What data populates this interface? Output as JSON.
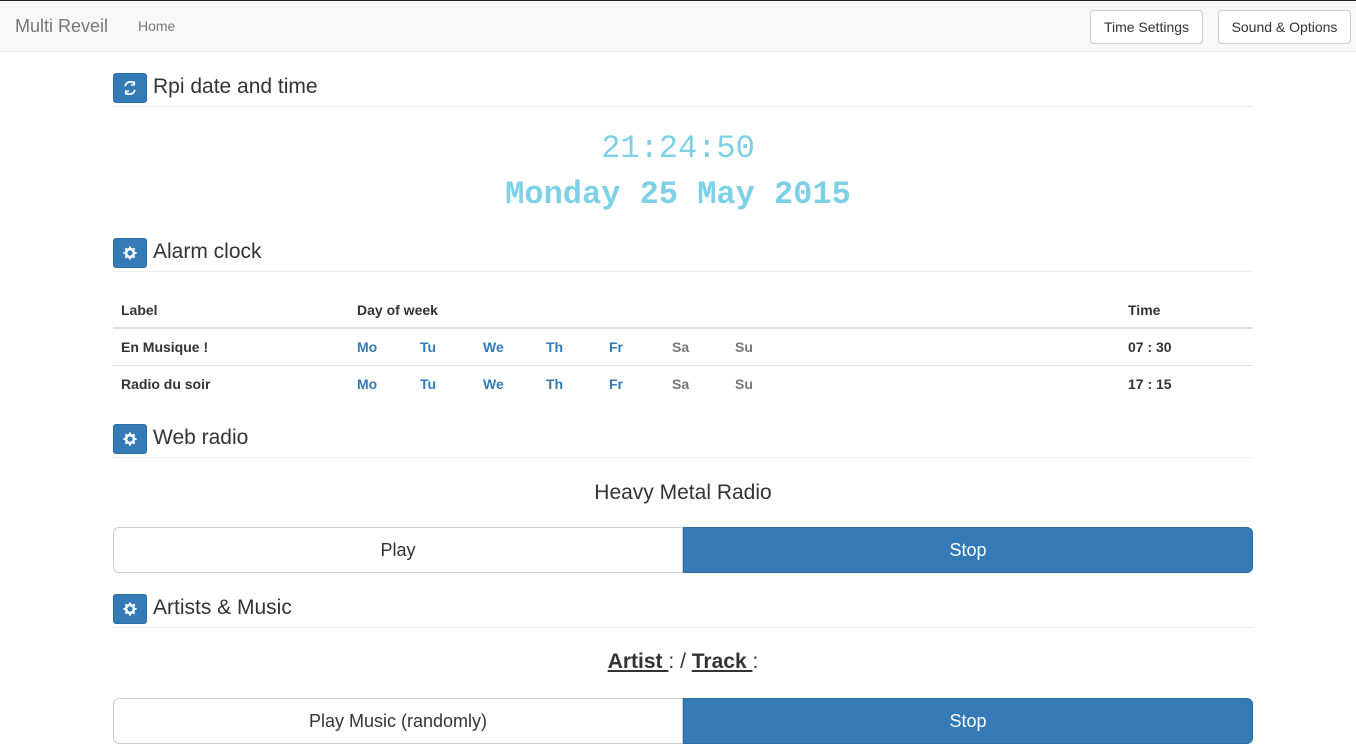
{
  "navbar": {
    "brand": "Multi Reveil",
    "home": "Home",
    "time_settings": "Time Settings",
    "sound_options": "Sound & Options"
  },
  "sections": {
    "datetime": {
      "title": "Rpi date and time",
      "icon": "refresh-icon"
    },
    "alarm": {
      "title": "Alarm clock",
      "icon": "gear-icon"
    },
    "radio": {
      "title": "Web radio",
      "icon": "gear-icon"
    },
    "music": {
      "title": "Artists & Music",
      "icon": "gear-icon"
    }
  },
  "clock": {
    "time": "21:24:50",
    "date": "Monday 25 May 2015"
  },
  "alarm_table": {
    "headers": [
      "Label",
      "Day of week",
      "",
      "Time"
    ],
    "rows": [
      {
        "label": "En Musique !",
        "days": [
          {
            "d": "Mo",
            "active": true
          },
          {
            "d": "Tu",
            "active": true
          },
          {
            "d": "We",
            "active": true
          },
          {
            "d": "Th",
            "active": true
          },
          {
            "d": "Fr",
            "active": true
          },
          {
            "d": "Sa",
            "active": false
          },
          {
            "d": "Su",
            "active": false
          }
        ],
        "time": "07 : 30"
      },
      {
        "label": "Radio du soir",
        "days": [
          {
            "d": "Mo",
            "active": true
          },
          {
            "d": "Tu",
            "active": true
          },
          {
            "d": "We",
            "active": true
          },
          {
            "d": "Th",
            "active": true
          },
          {
            "d": "Fr",
            "active": true
          },
          {
            "d": "Sa",
            "active": false
          },
          {
            "d": "Su",
            "active": false
          }
        ],
        "time": "17 : 15"
      }
    ]
  },
  "radio": {
    "station": "Heavy Metal Radio",
    "play": "Play",
    "stop": "Stop"
  },
  "music": {
    "artist_label": "Artist ",
    "sep1": ":",
    "slash": "/",
    "track_label": "Track ",
    "sep2": ":",
    "play": "Play Music (randomly)",
    "stop": "Stop"
  },
  "colors": {
    "primary": "#337ab7",
    "clock": "#7ed0e6",
    "day_active": "#337ab7",
    "day_inactive": "#777777"
  }
}
